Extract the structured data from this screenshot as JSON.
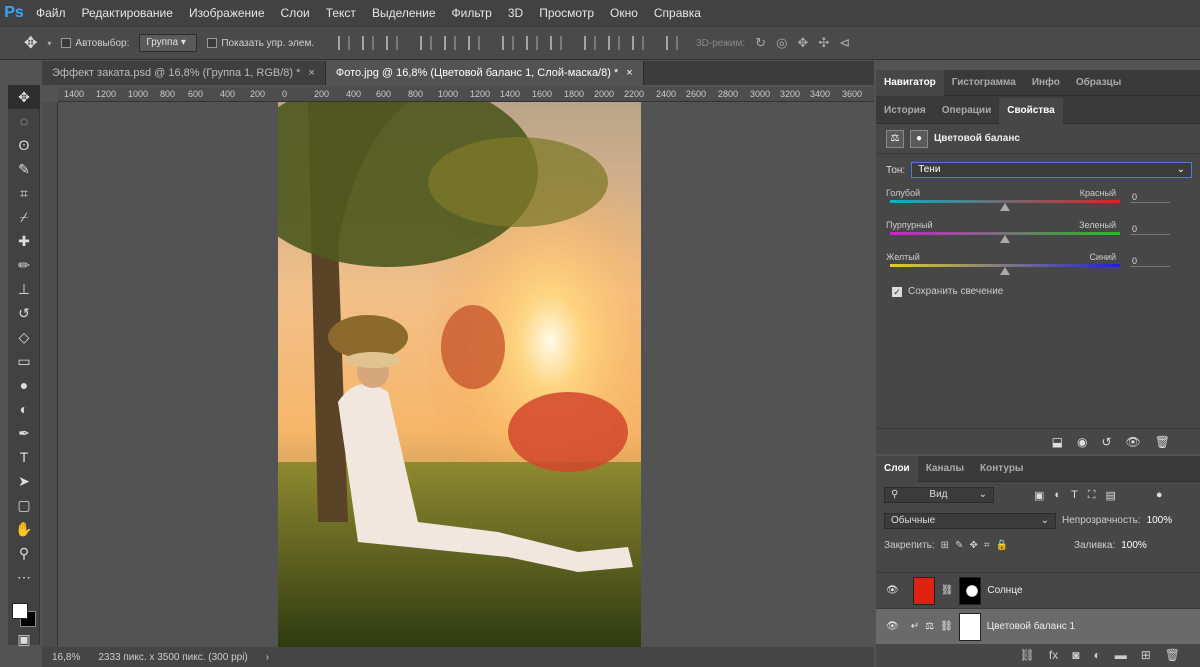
{
  "app": {
    "logo": "Ps"
  },
  "menu": [
    "Файл",
    "Редактирование",
    "Изображение",
    "Слои",
    "Текст",
    "Выделение",
    "Фильтр",
    "3D",
    "Просмотр",
    "Окно",
    "Справка"
  ],
  "options": {
    "autoselect_label": "Автовыбор:",
    "autoselect_value": "Группа",
    "show_controls_label": "Показать упр. элем.",
    "mode_3d_label": "3D-режим:"
  },
  "tabs": [
    {
      "label": "Эффект заката.psd @ 16,8% (Группа 1, RGB/8) *",
      "close": "×"
    },
    {
      "label": "Фото.jpg @ 16,8% (Цветовой баланс 1, Слой-маска/8) *",
      "close": "×"
    }
  ],
  "ruler": [
    "1400",
    "1200",
    "1000",
    "800",
    "600",
    "400",
    "200",
    "0",
    "200",
    "400",
    "600",
    "800",
    "1000",
    "1200",
    "1400",
    "1600",
    "1800",
    "2000",
    "2200",
    "2400",
    "2600",
    "2800",
    "3000",
    "3200",
    "3400",
    "3600"
  ],
  "status": {
    "zoom": "16,8%",
    "dimensions": "2333 пикс. x 3500 пикс. (300 ppi)",
    "arrow": "›"
  },
  "top_panel_tabs": [
    "Навигатор",
    "Гистограмма",
    "Инфо",
    "Образцы"
  ],
  "props_panel_tabs": [
    "История",
    "Операции",
    "Свойства"
  ],
  "properties": {
    "title": "Цветовой баланс",
    "tone_label": "Тон:",
    "tone_value": "Тени",
    "sliders": [
      {
        "left": "Голубой",
        "right": "Красный",
        "value": "0",
        "colors": [
          "#00b4c8",
          "#e02020"
        ]
      },
      {
        "left": "Пурпурный",
        "right": "Зеленый",
        "value": "0",
        "colors": [
          "#d020d0",
          "#20c020"
        ]
      },
      {
        "left": "Желтый",
        "right": "Синий",
        "value": "0",
        "colors": [
          "#e0d020",
          "#2020e0"
        ]
      }
    ],
    "preserve_label": "Сохранить свечение"
  },
  "layers_panel_tabs": [
    "Слои",
    "Каналы",
    "Контуры"
  ],
  "layers": {
    "filter_value": "Вид",
    "blend_mode": "Обычные",
    "opacity_label": "Непрозрачность:",
    "opacity_value": "100%",
    "lock_label": "Закрепить:",
    "fill_label": "Заливка:",
    "fill_value": "100%",
    "items": [
      {
        "name": "Солнце"
      },
      {
        "name": "Цветовой баланс 1"
      }
    ]
  }
}
